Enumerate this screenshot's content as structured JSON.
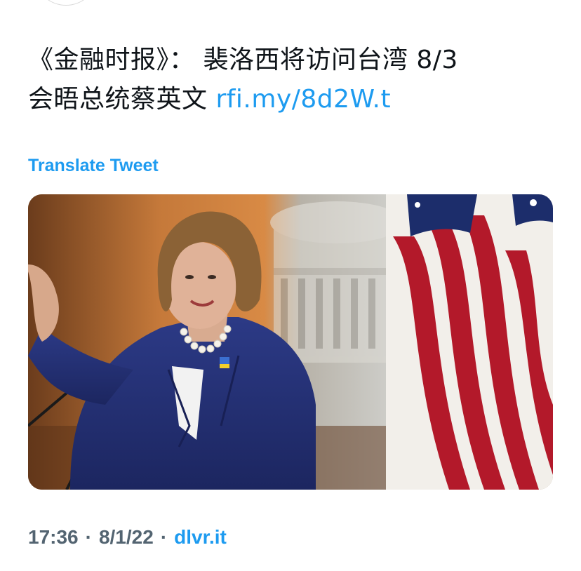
{
  "tweet": {
    "text_line1": "《金融时报》： 裴洛西将访问台湾 8/3",
    "text_line2_prefix": "会晤总统蔡英文 ",
    "link_text": "rfi.my/8d2W.t"
  },
  "translate_label": "Translate Tweet",
  "meta": {
    "time": "17:36",
    "separator": "·",
    "date": "8/1/22",
    "source": "dlvr.it"
  },
  "colors": {
    "link": "#1d9bf0",
    "text": "#0f1419",
    "secondary": "#536471"
  }
}
